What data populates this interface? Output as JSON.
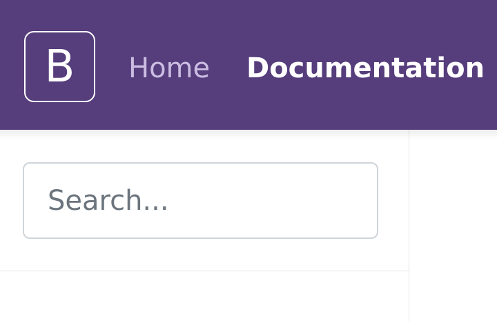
{
  "navbar": {
    "brand_letter": "B",
    "links": [
      {
        "label": "Home",
        "active": false
      },
      {
        "label": "Documentation",
        "active": true
      }
    ],
    "background_color": "#563d7c"
  },
  "sidebar": {
    "search": {
      "value": "",
      "placeholder": "Search..."
    }
  }
}
